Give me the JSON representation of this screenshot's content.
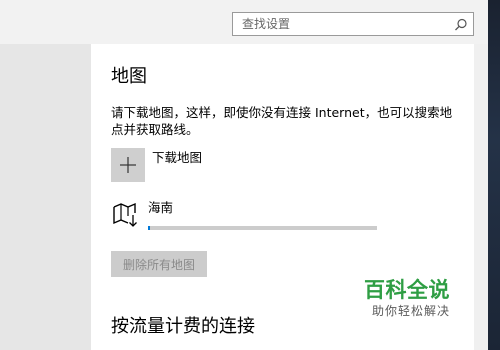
{
  "search": {
    "placeholder": "查找设置"
  },
  "maps": {
    "title": "地图",
    "description": "请下载地图，这样，即使你没有连接 Internet，也可以搜索地点并获取路线。",
    "download_label": "下载地图",
    "region": {
      "name": "海南",
      "progress": 0.01
    },
    "delete_all_label": "删除所有地图"
  },
  "metered": {
    "heading": "按流量计费的连接"
  },
  "watermark": {
    "title": "百科全说",
    "subtitle": "助你轻松解决"
  },
  "colors": {
    "accent": "#0078d7",
    "watermark": "#2f9e44"
  }
}
